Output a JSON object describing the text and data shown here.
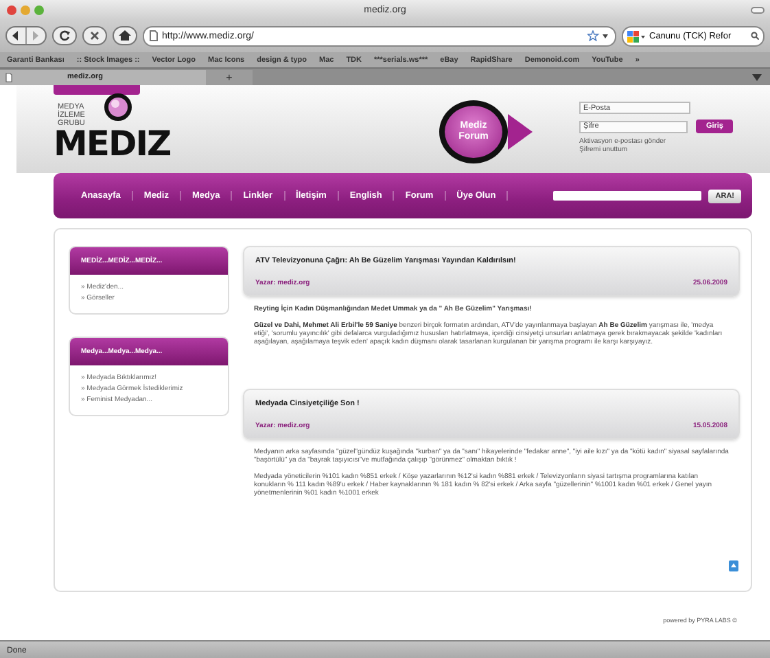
{
  "window": {
    "title": "mediz.org"
  },
  "toolbar": {
    "url": "http://www.mediz.org/",
    "search": "Canunu (TCK) Refor"
  },
  "bookmarks": [
    "Garanti Bankası",
    ":: Stock Images ::",
    "Vector Logo",
    "Mac Icons",
    "design & typo",
    "Mac",
    "TDK",
    "***serials.ws***",
    "eBay",
    "RapidShare",
    "Demonoid.com",
    "YouTube",
    "»"
  ],
  "tabs": [
    {
      "label": "mediz.org",
      "selected": true
    }
  ],
  "new_tab": "+",
  "site": {
    "logo_caption": [
      "MEDYA",
      "İZLEME",
      "GRUBU"
    ],
    "logo": "MEDIZ",
    "forum_badge": "Mediz Forum",
    "login": {
      "email_placeholder": "E-Posta",
      "password_placeholder": "Şifre",
      "button": "Giriş",
      "links": [
        "Aktivasyon e-postası gönder",
        "Şifremi unuttum"
      ]
    },
    "nav": {
      "items": [
        "Anasayfa",
        "Mediz",
        "Medya",
        "Linkler",
        "İletişim",
        "English",
        "Forum",
        "Üye Olun"
      ],
      "search_button": "ARA!"
    },
    "sidebar": [
      {
        "title": "MEDİZ...MEDİZ...MEDİZ...",
        "items": [
          "» Mediz'den...",
          "» Görseller"
        ]
      },
      {
        "title": "Medya...Medya...Medya...",
        "items": [
          "» Medyada Bıktıklarımız!",
          "» Medyada Görmek İstediklerimiz",
          "» Feminist Medyadan..."
        ]
      }
    ],
    "articles": [
      {
        "title": "ATV Televizyonuna Çağrı: Ah Be Güzelim Yarışması Yayından Kaldırılsın!",
        "author": "Yazar: mediz.org",
        "date": "25.06.2009",
        "subtitle": "Reyting İçin Kadın Düşmanlığından Medet Ummak ya da \" Ah Be Güzelim\" Yarışması!",
        "paragraphs": [
          "**Güzel ve Dahi, Mehmet Ali Erbil'le 59 Saniye** benzeri birçok formatın ardından, ATV'de yayınlanmaya başlayan **Ah Be Güzelim** yarışması ile, 'medya etiği', 'sorumlu yayıncılık' gibi defalarca vurguladığımız hususları hatırlatmaya, içerdiği cinsiyetçi unsurları anlatmaya gerek bırakmayacak şekilde 'kadınları aşağılayan, aşağılamaya teşvik eden' apaçık kadın düşmanı olarak tasarlanan kurgulanan bir yarışma programı ile karşı karşıyayız."
        ]
      },
      {
        "title": "Medyada Cinsiyetçiliğe Son !",
        "author": "Yazar: mediz.org",
        "date": "15.05.2008",
        "paragraphs": [
          "Medyanın arka sayfasında \"güzel\"gündüz kuşağında \"kurban\" ya da \"sanı\" hikayelerinde \"fedakar anne\", \"iyi aile kızı\" ya da \"kötü kadın\" siyasal sayfalarında \"başörtülü\" ya da \"bayrak taşıyıcısı\"ve mutfağında çalışıp \"görünmez\" olmaktan bıktık !",
          "Medyada yöneticilerin %101 kadın %851 erkek / Köşe yazarlarının %12'si kadın %881 erkek / Televizyonların siyasi tartışma programlarına katılan konukların % 111 kadın %89'u erkek / Haber kaynaklarının % 181 kadın % 82'si erkek / Arka sayfa \"güzellerinin\" %1001 kadın %01 erkek / Genel yayın yönetmenlerinin %01 kadın %1001 erkek"
        ]
      }
    ],
    "footer": "powered by PYRA LABS ©"
  },
  "status_bar": "Done"
}
